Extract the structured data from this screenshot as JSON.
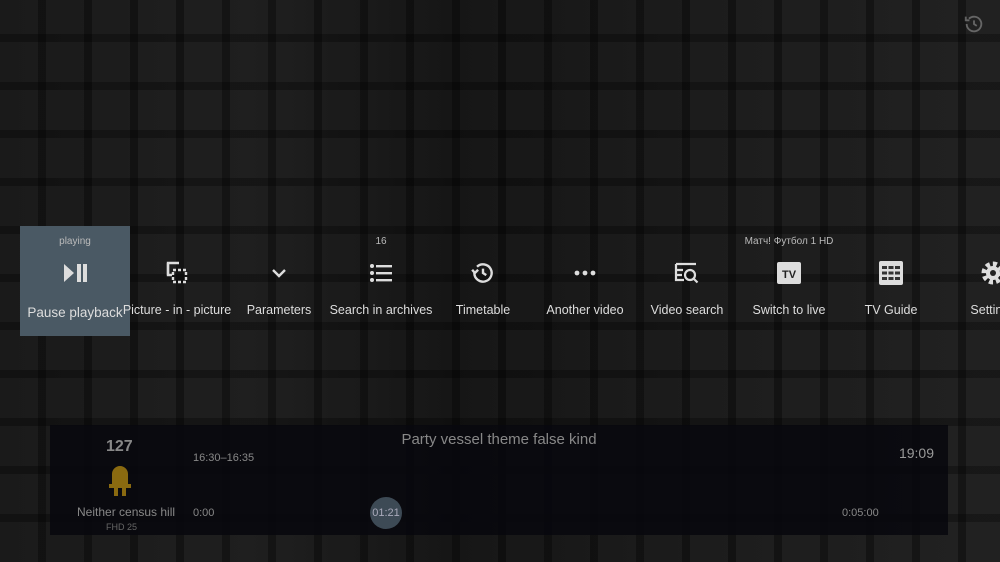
{
  "menu": {
    "items": [
      {
        "label": "Pause playback",
        "top": "playing",
        "icon": "play-pause-icon",
        "focused": true
      },
      {
        "label": "Picture - in - picture",
        "icon": "picture-in-picture-icon"
      },
      {
        "label": "Parameters",
        "icon": "chevron-down-icon"
      },
      {
        "label": "Search in archives",
        "top": "16",
        "icon": "list-icon"
      },
      {
        "label": "Timetable",
        "icon": "history-icon"
      },
      {
        "label": "Another video",
        "icon": "more-dots-icon"
      },
      {
        "label": "Video search",
        "icon": "video-search-icon"
      },
      {
        "label": "Switch to live",
        "top": "Матч! Футбол 1 HD",
        "icon": "tv-icon"
      },
      {
        "label": "TV Guide",
        "icon": "grid-icon"
      },
      {
        "label": "Settings",
        "icon": "gear-icon"
      }
    ]
  },
  "panel": {
    "channel_number": "127",
    "channel_name": "Neither census hill",
    "channel_quality": "FHD 25",
    "program_title": "Party vessel theme false kind",
    "program_time": "16:30–16:35",
    "clock": "19:09",
    "start_time": "0:00",
    "current_time": "01:21",
    "end_time": "0:05:00",
    "progress_fraction": 0.27,
    "logo_color": "#8a6a10"
  }
}
